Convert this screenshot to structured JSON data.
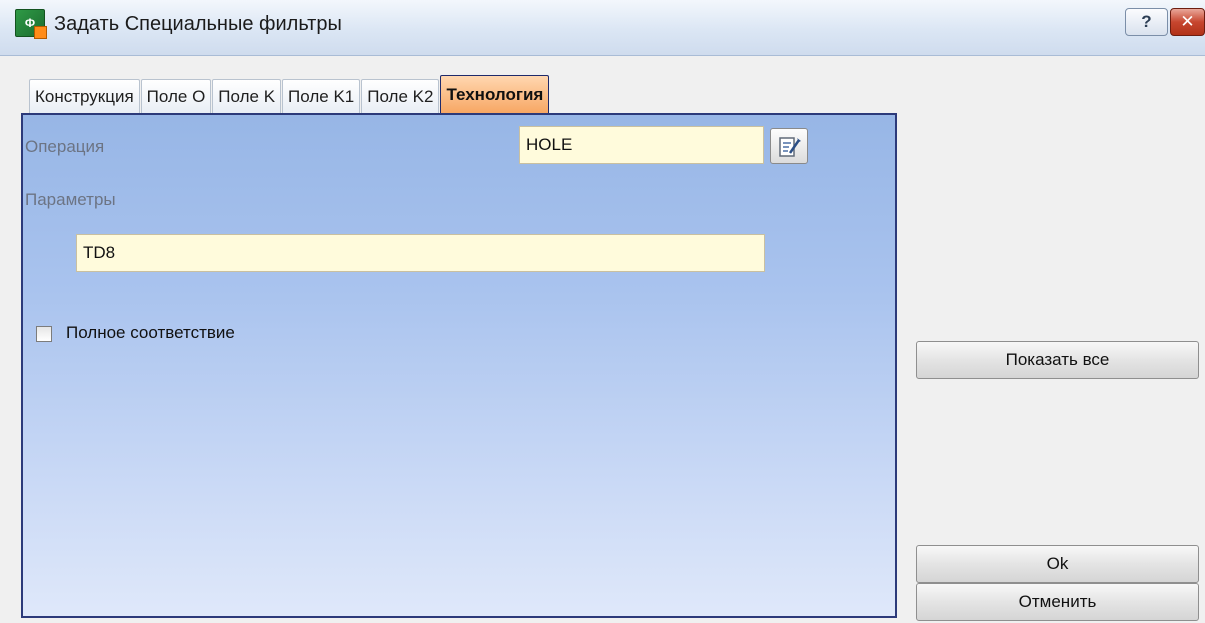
{
  "window": {
    "title": "Задать Специальные фильтры",
    "help_label": "?",
    "close_label": "✕"
  },
  "tabs": [
    {
      "label": "Конструкция",
      "active": false
    },
    {
      "label": "Поле O",
      "active": false
    },
    {
      "label": "Поле K",
      "active": false
    },
    {
      "label": "Поле K1",
      "active": false
    },
    {
      "label": "Поле K2",
      "active": false
    },
    {
      "label": "Технология",
      "active": true
    }
  ],
  "form": {
    "operation_label": "Операция",
    "operation_value": "HOLE",
    "parameters_label": "Параметры",
    "parameters_value": "TD8",
    "exact_match_label": "Полное соответствие",
    "exact_match_checked": false
  },
  "buttons": {
    "show_all": "Показать все",
    "ok": "Ok",
    "cancel": "Отменить"
  },
  "colors": {
    "active_tab": "#f7a764",
    "panel_top": "#97b6e6",
    "field_bg": "#fffbdc"
  },
  "icons": {
    "app": "app-filter-icon",
    "picker": "edit-list-icon"
  }
}
